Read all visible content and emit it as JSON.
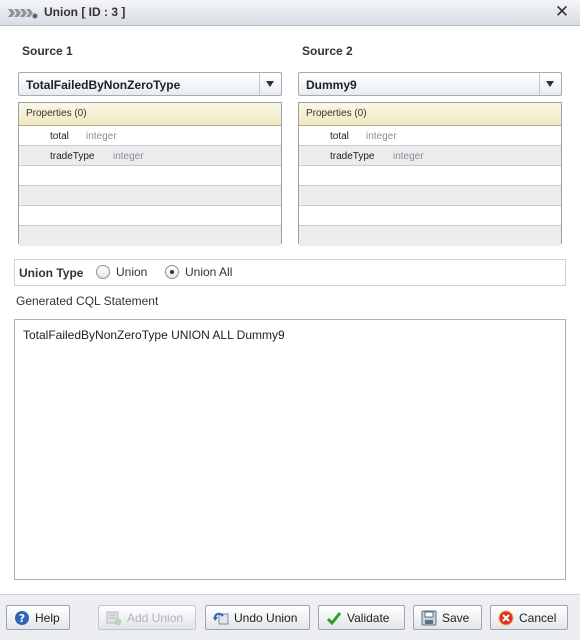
{
  "window": {
    "title": "Union [ ID : 3 ]",
    "close_glyph": "✕"
  },
  "source1": {
    "label": "Source 1",
    "selected": "TotalFailedByNonZeroType",
    "properties_header": "Properties (0)",
    "rows": [
      {
        "name": "total",
        "type": "integer"
      },
      {
        "name": "tradeType",
        "type": "integer"
      }
    ]
  },
  "source2": {
    "label": "Source 2",
    "selected": "Dummy9",
    "properties_header": "Properties (0)",
    "rows": [
      {
        "name": "total",
        "type": "integer"
      },
      {
        "name": "tradeType",
        "type": "integer"
      }
    ]
  },
  "union_type": {
    "label": "Union Type",
    "options": [
      {
        "label": "Union",
        "selected": false
      },
      {
        "label": "Union All",
        "selected": true
      }
    ]
  },
  "cql": {
    "label": "Generated CQL Statement",
    "statement": "TotalFailedByNonZeroType UNION ALL Dummy9"
  },
  "buttons": {
    "help": "Help",
    "add_union": "Add Union",
    "undo_union": "Undo Union",
    "validate": "Validate",
    "save": "Save",
    "cancel": "Cancel"
  },
  "colors": {
    "props_header_bg": "#efe8c2",
    "cancel_icon": "#d9332b",
    "validate_icon": "#2e9d2e",
    "help_icon": "#2f66b3"
  }
}
